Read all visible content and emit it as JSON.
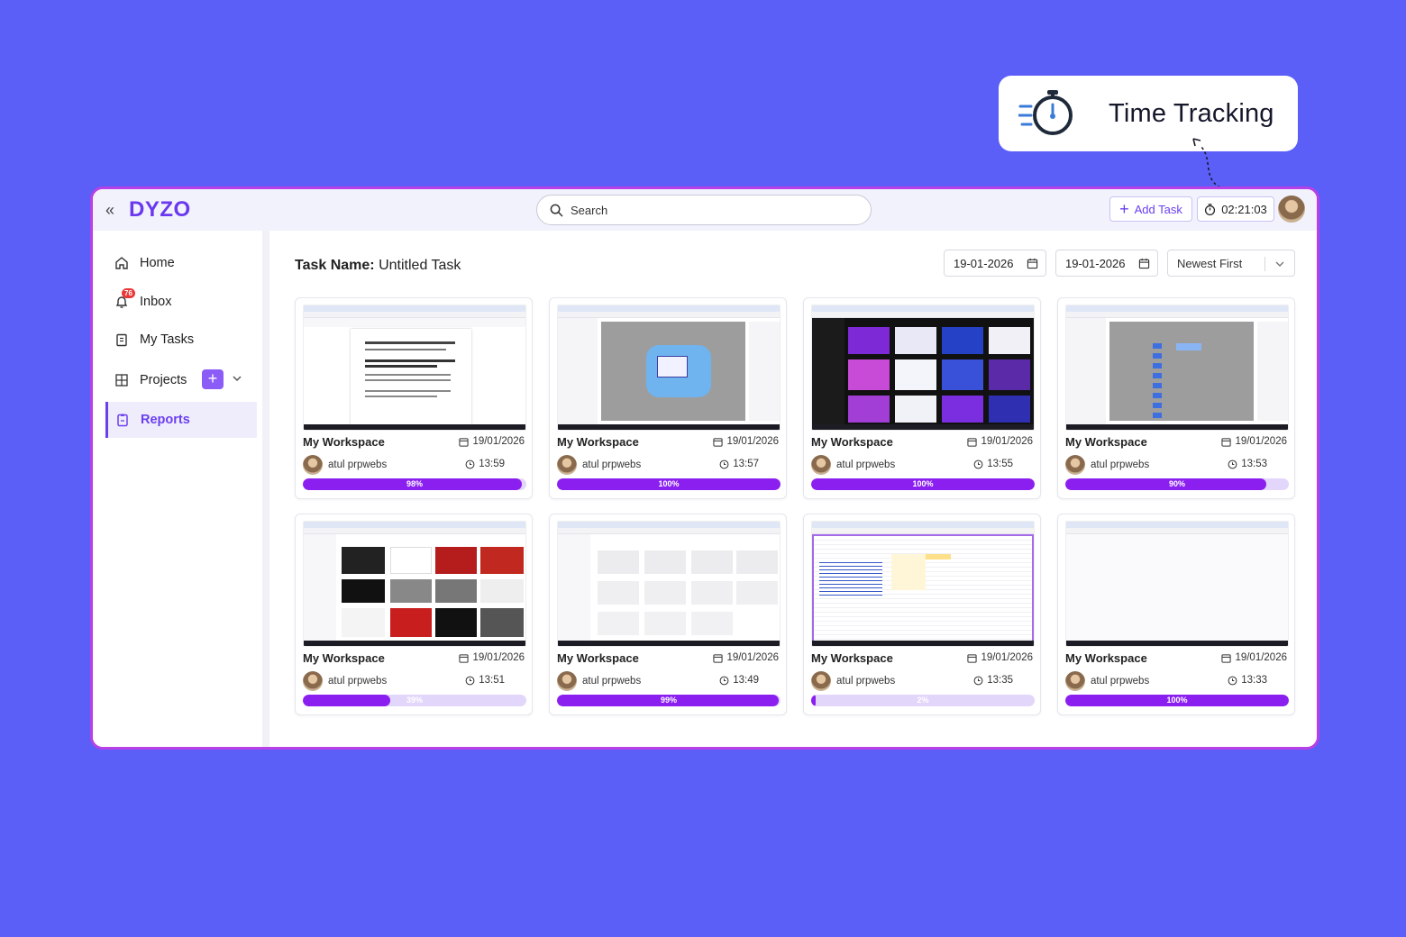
{
  "callout": {
    "label": "Time Tracking"
  },
  "app": {
    "logo": "DYZO",
    "search_placeholder": "Search",
    "add_task_label": "Add Task",
    "timer_value": "02:21:03"
  },
  "sidebar": {
    "items": [
      {
        "label": "Home",
        "icon": "home-icon"
      },
      {
        "label": "Inbox",
        "icon": "bell-icon",
        "badge": "76"
      },
      {
        "label": "My Tasks",
        "icon": "clipboard-icon"
      },
      {
        "label": "Projects",
        "icon": "grid-icon"
      },
      {
        "label": "Reports",
        "icon": "report-icon",
        "active": true
      }
    ]
  },
  "main": {
    "task_label": "Task Name:",
    "task_name": "Untitled Task",
    "date_from": "19-01-2026",
    "date_to": "19-01-2026",
    "sort": "Newest First",
    "cards": [
      {
        "workspace": "My Workspace",
        "date": "19/01/2026",
        "user": "atul prpwebs",
        "time": "13:59",
        "progress": 98,
        "progress_label": "98%"
      },
      {
        "workspace": "My Workspace",
        "date": "19/01/2026",
        "user": "atul prpwebs",
        "time": "13:57",
        "progress": 100,
        "progress_label": "100%"
      },
      {
        "workspace": "My Workspace",
        "date": "19/01/2026",
        "user": "atul prpwebs",
        "time": "13:55",
        "progress": 100,
        "progress_label": "100%"
      },
      {
        "workspace": "My Workspace",
        "date": "19/01/2026",
        "user": "atul prpwebs",
        "time": "13:53",
        "progress": 90,
        "progress_label": "90%"
      },
      {
        "workspace": "My Workspace",
        "date": "19/01/2026",
        "user": "atul prpwebs",
        "time": "13:51",
        "progress": 39,
        "progress_label": "39%"
      },
      {
        "workspace": "My Workspace",
        "date": "19/01/2026",
        "user": "atul prpwebs",
        "time": "13:49",
        "progress": 99,
        "progress_label": "99%"
      },
      {
        "workspace": "My Workspace",
        "date": "19/01/2026",
        "user": "atul prpwebs",
        "time": "13:35",
        "progress": 2,
        "progress_label": "2%"
      },
      {
        "workspace": "My Workspace",
        "date": "19/01/2026",
        "user": "atul prpwebs",
        "time": "13:33",
        "progress": 100,
        "progress_label": "100%"
      }
    ]
  },
  "colors": {
    "accent": "#6a3ff0",
    "progress": "#8b1ff0",
    "background": "#5b5ff7",
    "window_border": "#b740e6"
  }
}
